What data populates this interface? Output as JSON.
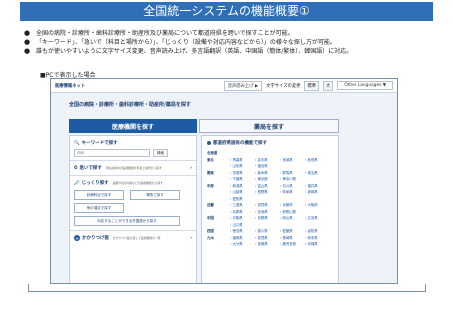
{
  "title": "全国統一システムの機能概要①",
  "bullets": [
    "全国の病院・診療所・歯科診療所・助産所及び薬局について都道府県を跨いで探すことが可能。",
    "「キーワード」、「急いで（科目と場所から）」、「じっくり（設備や対応内容などから）」の様々な探し方が可能。",
    "誰もが使いやすいように文字サイズ変更、音声読み上げ、多言語翻訳（英語、中国語（簡体/繁体）、韓国語）に対応。"
  ],
  "pc_label": "■PCで表示した場合",
  "site": {
    "logo": "医療情報ネット",
    "header_links": [
      "音声読み上げ ▶",
      "文字サイズの変更",
      "標準",
      "大"
    ],
    "language": "Other Languages ▼",
    "heading": "全国の病院・診療所・歯科診療所・助産所/薬局を探す",
    "tabs": [
      "医療機関を探す",
      "薬局を探す"
    ],
    "keyword": {
      "title": "キーワードで探す",
      "placeholder": "内科",
      "button": "検索"
    },
    "urgent": {
      "title": "急いで探す",
      "desc": "現在診療中の医療機関を科目と場所から探す"
    },
    "careful": {
      "title": "じっくり探す",
      "desc": "設備や対応内容などの医療機能から探す",
      "buttons": [
        "診療科目で探す",
        "場所で探す",
        "他の項目で探す"
      ],
      "combo": "対応することができる外国語から探す"
    },
    "family": {
      "title": "かかりつけ医",
      "desc": "かかりつけ医を探して医療機関の一覧"
    },
    "prefecture": {
      "title": "都道府県固有の機能で探す",
      "rows": [
        [
          "北海道",
          "",
          "",
          "",
          ""
        ],
        [
          "東北",
          "青森県",
          "岩手県",
          "宮城県",
          "秋田県"
        ],
        [
          "",
          "山形県",
          "福島県",
          "",
          ""
        ],
        [
          "関東",
          "茨城県",
          "栃木県",
          "群馬県",
          "埼玉県"
        ],
        [
          "",
          "千葉県",
          "東京都",
          "神奈川県",
          ""
        ],
        [
          "中部",
          "新潟県",
          "富山県",
          "石川県",
          "福井県"
        ],
        [
          "",
          "山梨県",
          "長野県",
          "岐阜県",
          "静岡県"
        ],
        [
          "",
          "愛知県",
          "",
          "",
          ""
        ],
        [
          "近畿",
          "三重県",
          "滋賀県",
          "京都府",
          "大阪府"
        ],
        [
          "",
          "兵庫県",
          "奈良県",
          "和歌山県",
          ""
        ],
        [
          "中国",
          "鳥取県",
          "島根県",
          "岡山県",
          "広島県"
        ],
        [
          "",
          "山口県",
          "",
          "",
          ""
        ],
        [
          "四国",
          "徳島県",
          "香川県",
          "愛媛県",
          "高知県"
        ],
        [
          "九州",
          "福岡県",
          "佐賀県",
          "長崎県",
          "熊本県"
        ],
        [
          "",
          "大分県",
          "宮崎県",
          "鹿児島県",
          "沖縄県"
        ]
      ]
    }
  }
}
